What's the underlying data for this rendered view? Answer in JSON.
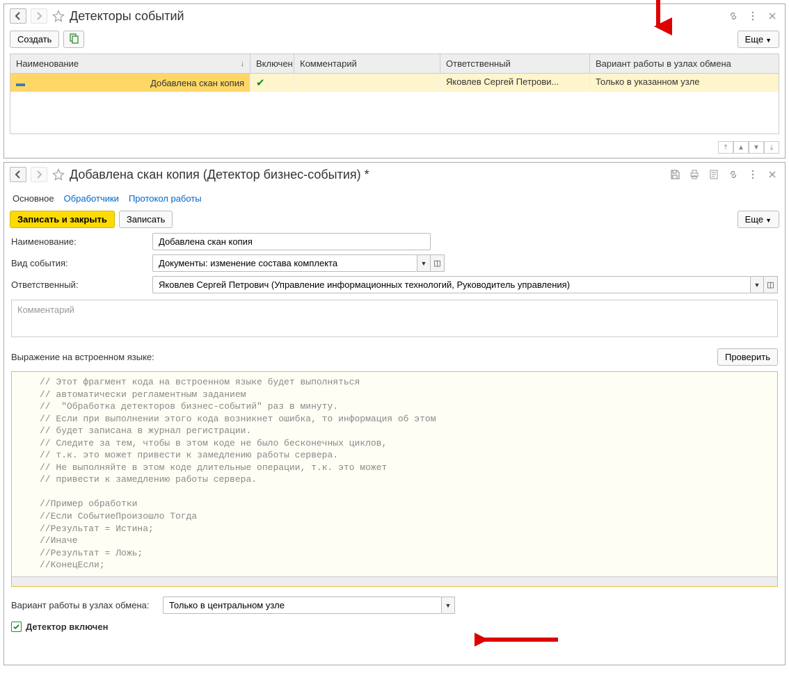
{
  "panel1": {
    "title": "Детекторы событий",
    "create_btn": "Создать",
    "more_btn": "Еще",
    "columns": {
      "name": "Наименование",
      "enabled": "Включен",
      "comment": "Комментарий",
      "responsible": "Ответственный",
      "variant": "Вариант работы в узлах обмена"
    },
    "row": {
      "name": "Добавлена скан копия",
      "responsible": "Яковлев Сергей Петрови...",
      "variant": "Только в указанном узле"
    }
  },
  "panel2": {
    "title": "Добавлена скан копия (Детектор бизнес-события) *",
    "tabs": {
      "main": "Основное",
      "handlers": "Обработчики",
      "log": "Протокол работы"
    },
    "save_close": "Записать и закрыть",
    "save": "Записать",
    "more_btn": "Еще",
    "labels": {
      "name": "Наименование:",
      "event_type": "Вид события:",
      "responsible": "Ответственный:",
      "comment_ph": "Комментарий",
      "code": "Выражение на встроенном языке:",
      "check_btn": "Проверить",
      "variant": "Вариант работы в узлах обмена:",
      "detector_enabled": "Детектор включен"
    },
    "values": {
      "name": "Добавлена скан копия",
      "event_type": "Документы: изменение состава комплекта",
      "responsible": "Яковлев Сергей Петрович (Управление информационных технологий, Руководитель управления)",
      "variant": "Только в центральном узле"
    },
    "code": "// Этот фрагмент кода на встроенном языке будет выполняться\n// автоматически регламентным заданием\n//  \"Обработка детекторов бизнес-событий\" раз в минуту.\n// Если при выполнении этого кода возникнет ошибка, то информация об этом\n// будет записана в журнал регистрации.\n// Следите за тем, чтобы в этом коде не было бесконечных циклов,\n// т.к. это может привести к замедлению работы сервера.\n// Не выполняйте в этом коде длительные операции, т.к. это может\n// привести к замедлению работы сервера.\n\n//Пример обработки\n//Если СобытиеПроизошло Тогда\n//Результат = Истина;\n//Иначе\n//Результат = Ложь;\n//КонецЕсли;"
  }
}
